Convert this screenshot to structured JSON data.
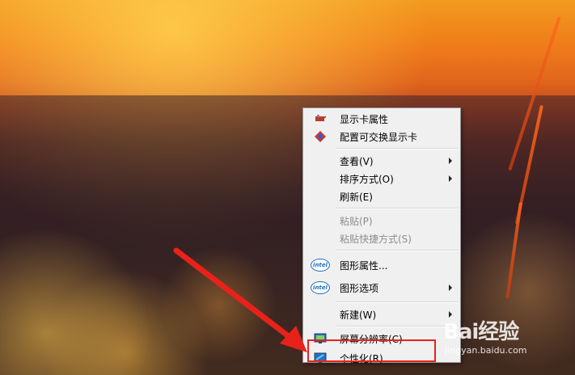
{
  "menu": {
    "items": [
      {
        "label": "显示卡属性",
        "icon": "graphics-card-icon"
      },
      {
        "label": "配置可交换显示卡",
        "icon": "switchable-graphics-icon"
      },
      {
        "label": "查看(V)",
        "submenu": true
      },
      {
        "label": "排序方式(O)",
        "submenu": true
      },
      {
        "label": "刷新(E)"
      },
      {
        "label": "粘贴(P)",
        "disabled": true
      },
      {
        "label": "粘贴快捷方式(S)",
        "disabled": true
      },
      {
        "label": "图形属性...",
        "icon": "intel-icon"
      },
      {
        "label": "图形选项",
        "icon": "intel-icon",
        "submenu": true
      },
      {
        "label": "新建(W)",
        "submenu": true
      },
      {
        "label": "屏幕分辨率(C)",
        "icon": "display-resolution-icon"
      },
      {
        "label": "个性化(R)",
        "icon": "personalize-icon"
      }
    ]
  },
  "intel_logo_text": "intel",
  "watermark": {
    "logo": "Bai经验",
    "sub": "jingyan.baidu.com"
  },
  "colors": {
    "highlight": "#e8221a",
    "menu_bg": "#f0f0f0"
  }
}
